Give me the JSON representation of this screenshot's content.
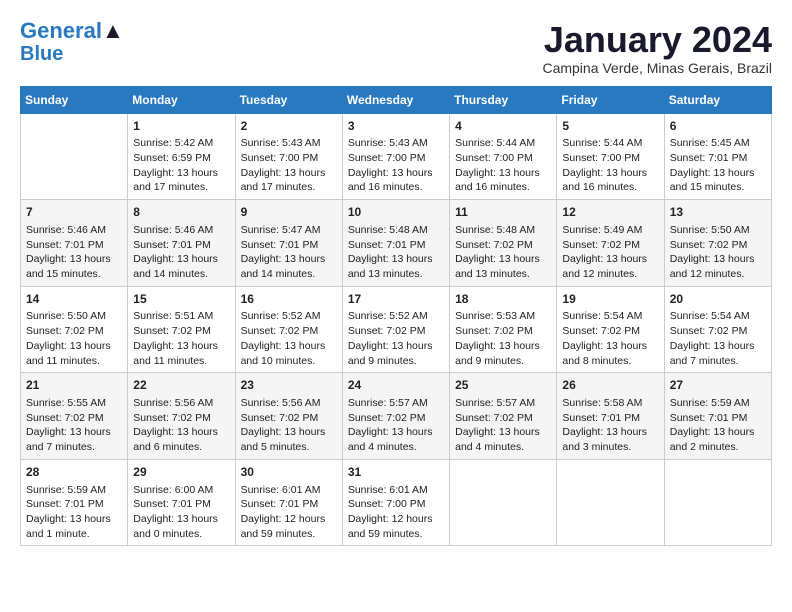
{
  "logo": {
    "line1": "General",
    "line2": "Blue"
  },
  "title": "January 2024",
  "location": "Campina Verde, Minas Gerais, Brazil",
  "days_of_week": [
    "Sunday",
    "Monday",
    "Tuesday",
    "Wednesday",
    "Thursday",
    "Friday",
    "Saturday"
  ],
  "weeks": [
    [
      {
        "day": "",
        "content": ""
      },
      {
        "day": "1",
        "content": "Sunrise: 5:42 AM\nSunset: 6:59 PM\nDaylight: 13 hours\nand 17 minutes."
      },
      {
        "day": "2",
        "content": "Sunrise: 5:43 AM\nSunset: 7:00 PM\nDaylight: 13 hours\nand 17 minutes."
      },
      {
        "day": "3",
        "content": "Sunrise: 5:43 AM\nSunset: 7:00 PM\nDaylight: 13 hours\nand 16 minutes."
      },
      {
        "day": "4",
        "content": "Sunrise: 5:44 AM\nSunset: 7:00 PM\nDaylight: 13 hours\nand 16 minutes."
      },
      {
        "day": "5",
        "content": "Sunrise: 5:44 AM\nSunset: 7:00 PM\nDaylight: 13 hours\nand 16 minutes."
      },
      {
        "day": "6",
        "content": "Sunrise: 5:45 AM\nSunset: 7:01 PM\nDaylight: 13 hours\nand 15 minutes."
      }
    ],
    [
      {
        "day": "7",
        "content": "Sunrise: 5:46 AM\nSunset: 7:01 PM\nDaylight: 13 hours\nand 15 minutes."
      },
      {
        "day": "8",
        "content": "Sunrise: 5:46 AM\nSunset: 7:01 PM\nDaylight: 13 hours\nand 14 minutes."
      },
      {
        "day": "9",
        "content": "Sunrise: 5:47 AM\nSunset: 7:01 PM\nDaylight: 13 hours\nand 14 minutes."
      },
      {
        "day": "10",
        "content": "Sunrise: 5:48 AM\nSunset: 7:01 PM\nDaylight: 13 hours\nand 13 minutes."
      },
      {
        "day": "11",
        "content": "Sunrise: 5:48 AM\nSunset: 7:02 PM\nDaylight: 13 hours\nand 13 minutes."
      },
      {
        "day": "12",
        "content": "Sunrise: 5:49 AM\nSunset: 7:02 PM\nDaylight: 13 hours\nand 12 minutes."
      },
      {
        "day": "13",
        "content": "Sunrise: 5:50 AM\nSunset: 7:02 PM\nDaylight: 13 hours\nand 12 minutes."
      }
    ],
    [
      {
        "day": "14",
        "content": "Sunrise: 5:50 AM\nSunset: 7:02 PM\nDaylight: 13 hours\nand 11 minutes."
      },
      {
        "day": "15",
        "content": "Sunrise: 5:51 AM\nSunset: 7:02 PM\nDaylight: 13 hours\nand 11 minutes."
      },
      {
        "day": "16",
        "content": "Sunrise: 5:52 AM\nSunset: 7:02 PM\nDaylight: 13 hours\nand 10 minutes."
      },
      {
        "day": "17",
        "content": "Sunrise: 5:52 AM\nSunset: 7:02 PM\nDaylight: 13 hours\nand 9 minutes."
      },
      {
        "day": "18",
        "content": "Sunrise: 5:53 AM\nSunset: 7:02 PM\nDaylight: 13 hours\nand 9 minutes."
      },
      {
        "day": "19",
        "content": "Sunrise: 5:54 AM\nSunset: 7:02 PM\nDaylight: 13 hours\nand 8 minutes."
      },
      {
        "day": "20",
        "content": "Sunrise: 5:54 AM\nSunset: 7:02 PM\nDaylight: 13 hours\nand 7 minutes."
      }
    ],
    [
      {
        "day": "21",
        "content": "Sunrise: 5:55 AM\nSunset: 7:02 PM\nDaylight: 13 hours\nand 7 minutes."
      },
      {
        "day": "22",
        "content": "Sunrise: 5:56 AM\nSunset: 7:02 PM\nDaylight: 13 hours\nand 6 minutes."
      },
      {
        "day": "23",
        "content": "Sunrise: 5:56 AM\nSunset: 7:02 PM\nDaylight: 13 hours\nand 5 minutes."
      },
      {
        "day": "24",
        "content": "Sunrise: 5:57 AM\nSunset: 7:02 PM\nDaylight: 13 hours\nand 4 minutes."
      },
      {
        "day": "25",
        "content": "Sunrise: 5:57 AM\nSunset: 7:02 PM\nDaylight: 13 hours\nand 4 minutes."
      },
      {
        "day": "26",
        "content": "Sunrise: 5:58 AM\nSunset: 7:01 PM\nDaylight: 13 hours\nand 3 minutes."
      },
      {
        "day": "27",
        "content": "Sunrise: 5:59 AM\nSunset: 7:01 PM\nDaylight: 13 hours\nand 2 minutes."
      }
    ],
    [
      {
        "day": "28",
        "content": "Sunrise: 5:59 AM\nSunset: 7:01 PM\nDaylight: 13 hours\nand 1 minute."
      },
      {
        "day": "29",
        "content": "Sunrise: 6:00 AM\nSunset: 7:01 PM\nDaylight: 13 hours\nand 0 minutes."
      },
      {
        "day": "30",
        "content": "Sunrise: 6:01 AM\nSunset: 7:01 PM\nDaylight: 12 hours\nand 59 minutes."
      },
      {
        "day": "31",
        "content": "Sunrise: 6:01 AM\nSunset: 7:00 PM\nDaylight: 12 hours\nand 59 minutes."
      },
      {
        "day": "",
        "content": ""
      },
      {
        "day": "",
        "content": ""
      },
      {
        "day": "",
        "content": ""
      }
    ]
  ]
}
